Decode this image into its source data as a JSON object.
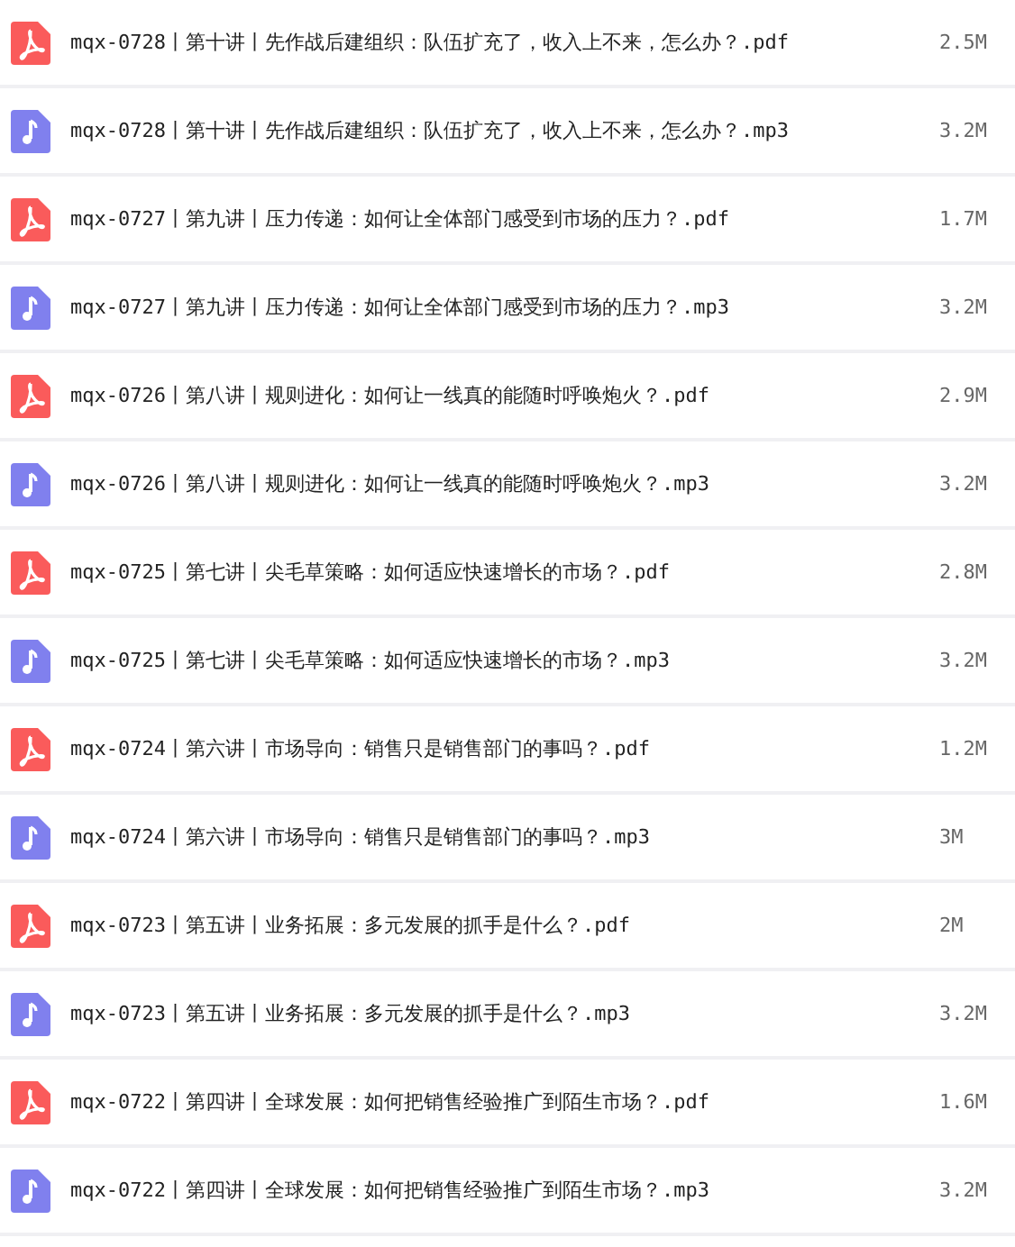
{
  "files": [
    {
      "kind": "pdf",
      "name": "mqx-0728丨第十讲丨先作战后建组织：队伍扩充了，收入上不来，怎么办？.pdf",
      "size": "2.5M"
    },
    {
      "kind": "audio",
      "name": "mqx-0728丨第十讲丨先作战后建组织：队伍扩充了，收入上不来，怎么办？.mp3",
      "size": "3.2M"
    },
    {
      "kind": "pdf",
      "name": "mqx-0727丨第九讲丨压力传递：如何让全体部门感受到市场的压力？.pdf",
      "size": "1.7M"
    },
    {
      "kind": "audio",
      "name": "mqx-0727丨第九讲丨压力传递：如何让全体部门感受到市场的压力？.mp3",
      "size": "3.2M"
    },
    {
      "kind": "pdf",
      "name": "mqx-0726丨第八讲丨规则进化：如何让一线真的能随时呼唤炮火？.pdf",
      "size": "2.9M"
    },
    {
      "kind": "audio",
      "name": "mqx-0726丨第八讲丨规则进化：如何让一线真的能随时呼唤炮火？.mp3",
      "size": "3.2M"
    },
    {
      "kind": "pdf",
      "name": "mqx-0725丨第七讲丨尖毛草策略：如何适应快速增长的市场？.pdf",
      "size": "2.8M"
    },
    {
      "kind": "audio",
      "name": "mqx-0725丨第七讲丨尖毛草策略：如何适应快速增长的市场？.mp3",
      "size": "3.2M"
    },
    {
      "kind": "pdf",
      "name": "mqx-0724丨第六讲丨市场导向：销售只是销售部门的事吗？.pdf",
      "size": "1.2M"
    },
    {
      "kind": "audio",
      "name": "mqx-0724丨第六讲丨市场导向：销售只是销售部门的事吗？.mp3",
      "size": "3M"
    },
    {
      "kind": "pdf",
      "name": "mqx-0723丨第五讲丨业务拓展：多元发展的抓手是什么？.pdf",
      "size": "2M"
    },
    {
      "kind": "audio",
      "name": "mqx-0723丨第五讲丨业务拓展：多元发展的抓手是什么？.mp3",
      "size": "3.2M"
    },
    {
      "kind": "pdf",
      "name": "mqx-0722丨第四讲丨全球发展：如何把销售经验推广到陌生市场？.pdf",
      "size": "1.6M"
    },
    {
      "kind": "audio",
      "name": "mqx-0722丨第四讲丨全球发展：如何把销售经验推广到陌生市场？.mp3",
      "size": "3.2M"
    }
  ]
}
